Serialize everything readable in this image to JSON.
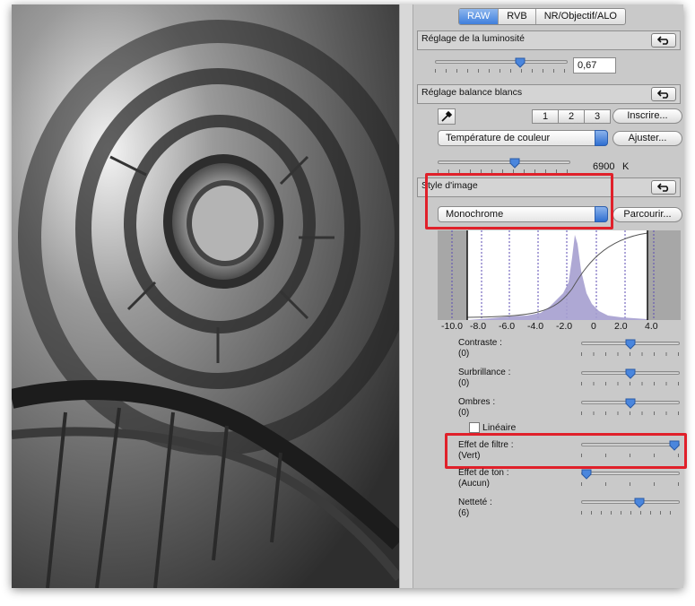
{
  "tabs": [
    {
      "label": "RAW",
      "active": true
    },
    {
      "label": "RVB",
      "active": false
    },
    {
      "label": "NR/Objectif/ALO",
      "active": false
    }
  ],
  "brightness": {
    "title": "Réglage de la luminosité",
    "value": "0,67",
    "level": 0.67
  },
  "white_balance": {
    "title": "Réglage balance blancs",
    "presets": [
      "1",
      "2",
      "3"
    ],
    "register_label": "Inscrire...",
    "mode": "Température de couleur",
    "adjust_label": "Ajuster...",
    "temperature": "6900",
    "unit": "K",
    "level": 0.6
  },
  "picture_style": {
    "title": "Style d'image",
    "selected": "Monochrome",
    "browse_label": "Parcourir..."
  },
  "histogram": {
    "axis_labels": [
      "-10.0",
      "-8.0",
      "-6.0",
      "-4.0",
      "-2.0",
      "0",
      "2.0",
      "4.0"
    ]
  },
  "parameters": [
    {
      "name": "Contraste :",
      "value": "(0)",
      "level": 0.5
    },
    {
      "name": "Surbrillance :",
      "value": "(0)",
      "level": 0.5
    },
    {
      "name": "Ombres :",
      "value": "(0)",
      "level": 0.5
    },
    {
      "name": "Effet de filtre :",
      "value": "(Vert)",
      "level": 1.0
    },
    {
      "name": "Effet de ton :",
      "value": "(Aucun)",
      "level": 0.0
    },
    {
      "name": "Netteté :",
      "value": "(6)",
      "level": 0.6
    }
  ],
  "linear": {
    "label": "Linéaire",
    "checked": false
  },
  "colors": {
    "highlight": "#e0202a",
    "accent": "#3f7fdc"
  },
  "icons": {
    "reset": "undo-arrow-icon",
    "eyedropper": "eyedropper-icon"
  }
}
